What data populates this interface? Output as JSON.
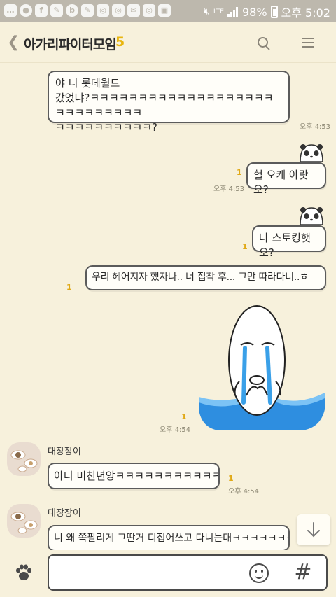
{
  "status_bar": {
    "battery": "98%",
    "network": "LTE",
    "time": "오후 5:02"
  },
  "header": {
    "title": "아가리파이터모임",
    "member_count": "5"
  },
  "messages": [
    {
      "sender": "",
      "text": "야 니 롯데월드\n갔었냐?ㅋㅋㅋㅋㅋㅋㅋㅋㅋㅋㅋㅋㅋㅋㅋㅋㅋㅋㅋㅋㅋㅋㅋㅋㅋㅋㅋㅋ\nㅋㅋㅋㅋㅋㅋㅋㅋㅋㅋ?",
      "time": "오후 4:53",
      "unread": ""
    },
    {
      "sender": "me",
      "text": "헐 오케 아랏오?",
      "time": "오후 4:53",
      "unread": "1"
    },
    {
      "sender": "me",
      "text": "나 스토킹햇오?",
      "time": "",
      "unread": "1"
    },
    {
      "sender": "me",
      "text": "우리 헤어지자 했자나.. 너 집착 후... 그만 따라다녀..ㅎ",
      "time": "",
      "unread": "1"
    },
    {
      "sender": "me",
      "sticker": "crying-egg-head",
      "time": "오후 4:54",
      "unread": "1"
    },
    {
      "sender": "대장장이",
      "text": "아니 미친년앙ㅋㅋㅋㅋㅋㅋㅋㅋㅋㅋㅋㅋㅋㅋㅋ",
      "time": "오후 4:54",
      "unread": "1"
    },
    {
      "sender": "대장장이",
      "text": "니 왜 쪽팔리게 그딴거 디집어쓰고 다니는대ㅋㅋㅋㅋㅋㅋㅋㅋ",
      "time": "",
      "unread": ""
    }
  ],
  "input": {
    "placeholder": ""
  },
  "icons": {
    "back": "chevron-left-icon",
    "search": "search-icon",
    "menu": "menu-icon",
    "emoji": "emoji-icon",
    "hash": "hash-icon",
    "paw": "paw-icon",
    "scroll_down": "arrow-down-icon"
  },
  "colors": {
    "background": "#f7f1dc",
    "accent_yellow": "#e8b50e",
    "bubble_border": "#5b5b5b"
  }
}
